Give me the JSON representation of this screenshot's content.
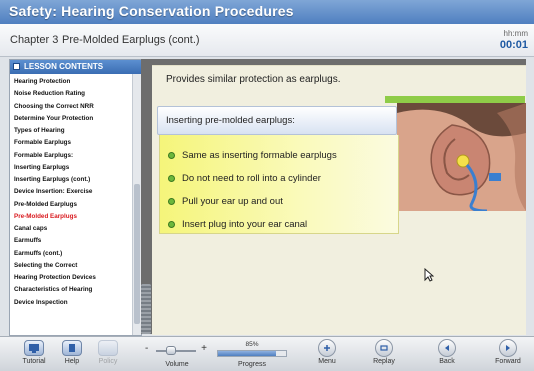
{
  "window": {
    "title": "Safety: Hearing Conservation Procedures"
  },
  "chapter": {
    "chapter": "Chapter 3",
    "topic": "Pre-Molded Earplugs (cont.)"
  },
  "timer": {
    "label": "hh:mm",
    "value": "00:01"
  },
  "sidebar": {
    "header": "LESSON CONTENTS",
    "active_index": 14,
    "items": [
      "Hearing Protection",
      "Noise Reduction Rating",
      "Choosing the Correct NRR",
      "Determine Your Protection",
      "Types of Hearing",
      "Formable Earplugs",
      "Formable Earplugs:",
      "Inserting Earplugs",
      "Inserting Earplugs (cont.)",
      "Device Insertion: Exercise",
      "Pre-Molded Earplugs",
      "Pre-Molded Earplugs",
      "Canal caps",
      "Earmuffs",
      "Earmuffs (cont.)",
      "Selecting the Correct",
      "Hearing Protection Devices",
      "Characteristics of Hearing",
      "Device Inspection"
    ]
  },
  "content": {
    "paragraph": "Provides similar protection as earplugs.",
    "instruction_title": "Inserting pre-molded earplugs:",
    "bullets": [
      "Same as inserting formable earplugs",
      "Do not need to roll into a cylinder",
      "Pull your ear up and out",
      "Insert plug into your ear canal"
    ]
  },
  "toolbar": {
    "tutorial": "Tutorial",
    "help": "Help",
    "policy": "Policy",
    "volume": "Volume",
    "volume_minus": "-",
    "volume_plus": "+",
    "progress_label": "Progress",
    "progress_pct_text": "85%",
    "progress_value": 85,
    "menu": "Menu",
    "replay": "Replay",
    "back": "Back",
    "forward": "Forward"
  },
  "colors": {
    "title_bar": "#4f7fc0",
    "active_item": "#d9191e",
    "bullet_green": "#6cb73c",
    "bullet_panel": "#f5f57a",
    "accent_green": "#8fcc48"
  }
}
